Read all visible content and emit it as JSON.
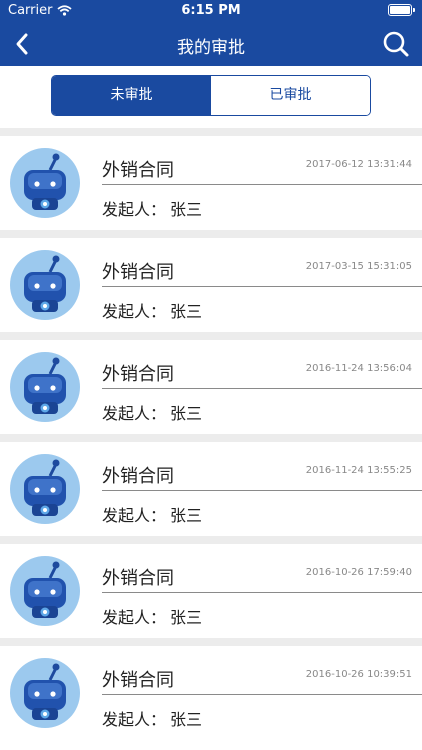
{
  "status_bar": {
    "carrier": "Carrier",
    "time": "6:15 PM"
  },
  "nav": {
    "title": "我的审批",
    "back_icon": "chevron-left-icon",
    "search_icon": "search-icon"
  },
  "tabs": [
    {
      "label": "未审批",
      "selected": true
    },
    {
      "label": "已审批",
      "selected": false
    }
  ],
  "colors": {
    "primary": "#1a4aa0",
    "separator": "#ececec",
    "avatar_bg": "#9cc9ee"
  },
  "items": [
    {
      "title": "外销合同",
      "time": "2017-06-12 13:31:44",
      "initiator_label": "发起人：",
      "initiator": "张三"
    },
    {
      "title": "外销合同",
      "time": "2017-03-15 15:31:05",
      "initiator_label": "发起人：",
      "initiator": "张三"
    },
    {
      "title": "外销合同",
      "time": "2016-11-24 13:56:04",
      "initiator_label": "发起人：",
      "initiator": "张三"
    },
    {
      "title": "外销合同",
      "time": "2016-11-24 13:55:25",
      "initiator_label": "发起人：",
      "initiator": "张三"
    },
    {
      "title": "外销合同",
      "time": "2016-10-26 17:59:40",
      "initiator_label": "发起人：",
      "initiator": "张三"
    },
    {
      "title": "外销合同",
      "time": "2016-10-26 10:39:51",
      "initiator_label": "发起人：",
      "initiator": "张三"
    }
  ]
}
